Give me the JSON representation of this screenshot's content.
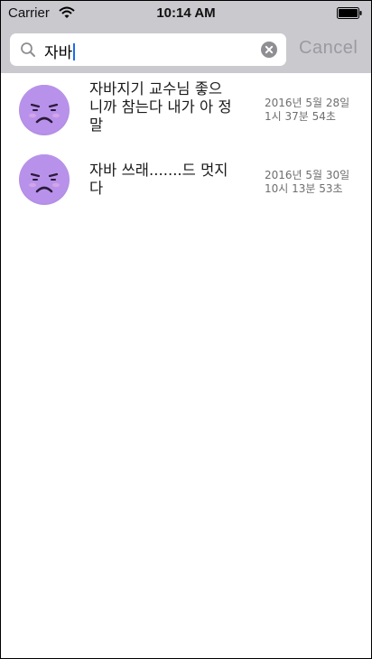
{
  "status_bar": {
    "carrier": "Carrier",
    "time": "10:14 AM"
  },
  "search": {
    "value": "자바",
    "cancel_label": "Cancel"
  },
  "results": [
    {
      "message_lines": [
        "자바지기 교수님 좋으",
        "니까 참는다 내가 아 정",
        "말"
      ],
      "date": "2016년 5월 28일",
      "time": "1시 37분 54초"
    },
    {
      "message_lines": [
        "자바 쓰래.......드 멋지",
        "다"
      ],
      "date": "2016년 5월 30일",
      "time": "10시 13분 53초"
    }
  ],
  "colors": {
    "bar_background": "#c9c9ce",
    "avatar": "#b48ee6",
    "cancel": "#9a9aa0",
    "caret": "#1a6cf0"
  },
  "icons": {
    "wifi": "wifi-icon",
    "battery": "battery-icon",
    "search": "search-icon",
    "clear": "clear-icon",
    "avatar": "sad-face-avatar"
  }
}
